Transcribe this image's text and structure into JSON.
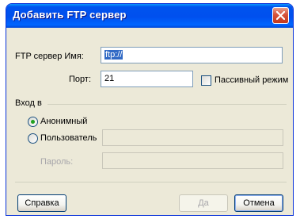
{
  "window": {
    "title": "Добавить FTP сервер"
  },
  "server": {
    "name_label": "FTP сервер Имя:",
    "name_value": "ftp://",
    "port_label": "Порт:",
    "port_value": "21",
    "passive_label": "Пассивный режим",
    "passive_checked": false
  },
  "login": {
    "group_label": "Вход в",
    "anonymous_label": "Анонимный",
    "anonymous_selected": true,
    "user_label": "Пользователь",
    "user_value": "",
    "password_label": "Пароль:",
    "password_value": ""
  },
  "buttons": {
    "help": "Справка",
    "ok": "Да",
    "cancel": "Отмена"
  },
  "colors": {
    "titlebar": "#0053EE",
    "dialog_bg": "#ECE9D8",
    "close_button": "#D6533A",
    "selection": "#316AC5",
    "radio_dot": "#21A121"
  }
}
